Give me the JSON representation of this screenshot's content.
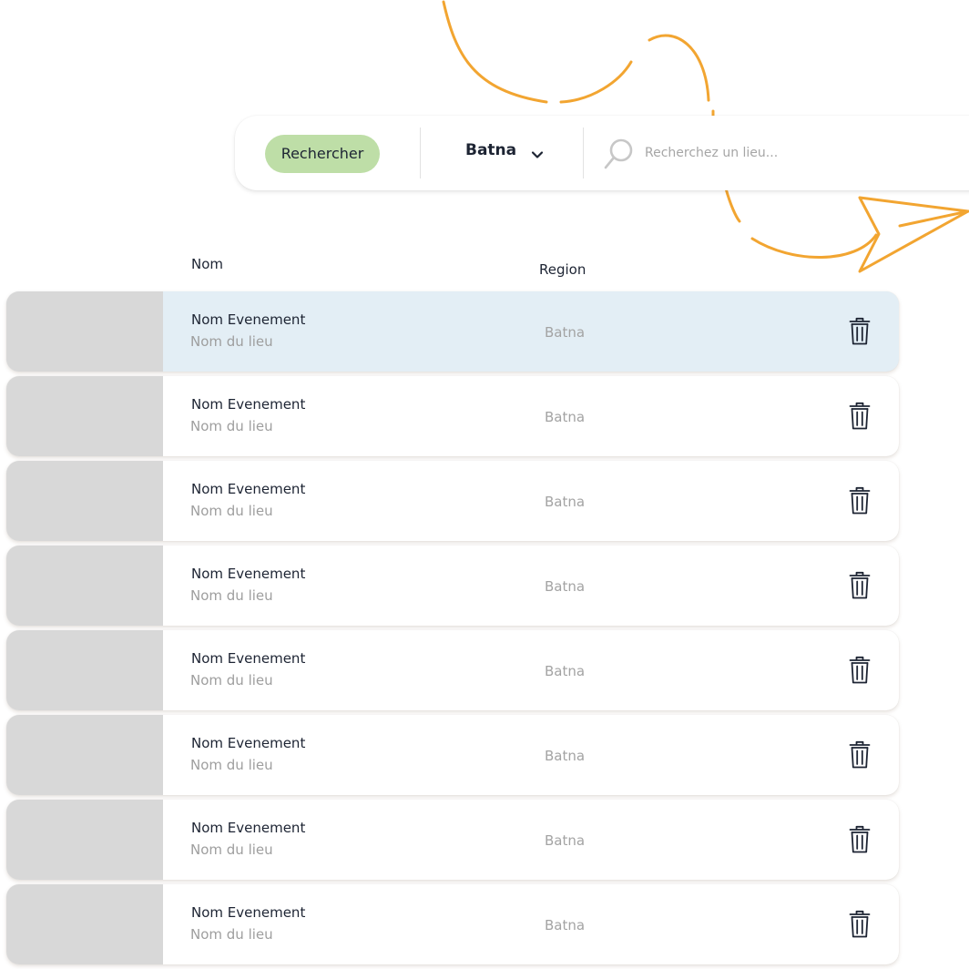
{
  "search_bar": {
    "button_label": "Rechercher",
    "region_value": "Batna",
    "placeholder": "Recherchez un lieu..."
  },
  "table": {
    "headers": {
      "nom": "Nom",
      "region": "Region"
    },
    "rows": [
      {
        "event": "Nom Evenement",
        "venue": "Nom du lieu",
        "region": "Batna",
        "selected": true
      },
      {
        "event": "Nom Evenement",
        "venue": "Nom du lieu",
        "region": "Batna",
        "selected": false
      },
      {
        "event": "Nom Evenement",
        "venue": "Nom du lieu",
        "region": "Batna",
        "selected": false
      },
      {
        "event": "Nom Evenement",
        "venue": "Nom du lieu",
        "region": "Batna",
        "selected": false
      },
      {
        "event": "Nom Evenement",
        "venue": "Nom du lieu",
        "region": "Batna",
        "selected": false
      },
      {
        "event": "Nom Evenement",
        "venue": "Nom du lieu",
        "region": "Batna",
        "selected": false
      },
      {
        "event": "Nom Evenement",
        "venue": "Nom du lieu",
        "region": "Batna",
        "selected": false
      },
      {
        "event": "Nom Evenement",
        "venue": "Nom du lieu",
        "region": "Batna",
        "selected": false
      }
    ]
  },
  "icons": {
    "row_action": "trash-icon",
    "dropdown": "chevron-down-icon",
    "search": "search-icon",
    "decoration": "paper-plane-icon"
  },
  "colors": {
    "accent_orange": "#f2a531",
    "button_green": "#bedea7",
    "selected_row": "#e3eef5",
    "thumbnail_gray": "#d8d8d8"
  }
}
